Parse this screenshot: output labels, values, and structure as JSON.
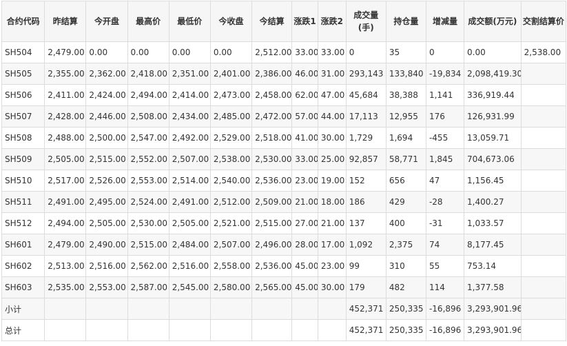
{
  "headers": [
    "合约代码",
    "昨结算",
    "今开盘",
    "最高价",
    "最低价",
    "今收盘",
    "今结算",
    "涨跌1",
    "涨跌2",
    "成交量(手)",
    "持仓量",
    "增减量",
    "成交额(万元)",
    "交割结算价"
  ],
  "rows": [
    [
      "SH504",
      "2,479.00",
      "0.00",
      "0.00",
      "0.00",
      "0.00",
      "2,512.00",
      "33.00",
      "33.00",
      "0",
      "35",
      "0",
      "0.00",
      "2,538.00"
    ],
    [
      "SH505",
      "2,355.00",
      "2,362.00",
      "2,418.00",
      "2,351.00",
      "2,401.00",
      "2,386.00",
      "46.00",
      "31.00",
      "293,143",
      "133,840",
      "-19,834",
      "2,098,419.30",
      ""
    ],
    [
      "SH506",
      "2,411.00",
      "2,424.00",
      "2,494.00",
      "2,414.00",
      "2,473.00",
      "2,458.00",
      "62.00",
      "47.00",
      "45,684",
      "38,388",
      "1,141",
      "336,919.44",
      ""
    ],
    [
      "SH507",
      "2,428.00",
      "2,446.00",
      "2,508.00",
      "2,434.00",
      "2,485.00",
      "2,472.00",
      "57.00",
      "44.00",
      "17,113",
      "12,955",
      "176",
      "126,931.99",
      ""
    ],
    [
      "SH508",
      "2,488.00",
      "2,500.00",
      "2,547.00",
      "2,492.00",
      "2,529.00",
      "2,518.00",
      "41.00",
      "30.00",
      "1,729",
      "1,694",
      "-455",
      "13,059.71",
      ""
    ],
    [
      "SH509",
      "2,505.00",
      "2,515.00",
      "2,552.00",
      "2,507.00",
      "2,538.00",
      "2,530.00",
      "33.00",
      "25.00",
      "92,857",
      "58,771",
      "1,845",
      "704,673.06",
      ""
    ],
    [
      "SH510",
      "2,517.00",
      "2,526.00",
      "2,553.00",
      "2,514.00",
      "2,540.00",
      "2,536.00",
      "23.00",
      "19.00",
      "152",
      "656",
      "47",
      "1,156.45",
      ""
    ],
    [
      "SH511",
      "2,491.00",
      "2,495.00",
      "2,524.00",
      "2,491.00",
      "2,512.00",
      "2,509.00",
      "21.00",
      "18.00",
      "186",
      "429",
      "-28",
      "1,400.27",
      ""
    ],
    [
      "SH512",
      "2,494.00",
      "2,505.00",
      "2,530.00",
      "2,505.00",
      "2,521.00",
      "2,515.00",
      "27.00",
      "21.00",
      "137",
      "400",
      "-31",
      "1,033.57",
      ""
    ],
    [
      "SH601",
      "2,479.00",
      "2,490.00",
      "2,515.00",
      "2,484.00",
      "2,507.00",
      "2,496.00",
      "28.00",
      "17.00",
      "1,092",
      "2,375",
      "74",
      "8,177.45",
      ""
    ],
    [
      "SH602",
      "2,513.00",
      "2,516.00",
      "2,562.00",
      "2,516.00",
      "2,558.00",
      "2,536.00",
      "45.00",
      "23.00",
      "99",
      "310",
      "55",
      "753.14",
      ""
    ],
    [
      "SH603",
      "2,535.00",
      "2,553.00",
      "2,587.00",
      "2,545.00",
      "2,580.00",
      "2,565.00",
      "45.00",
      "30.00",
      "179",
      "482",
      "114",
      "1,377.58",
      ""
    ]
  ],
  "summary": [
    [
      "小计",
      "",
      "",
      "",
      "",
      "",
      "",
      "",
      "",
      "452,371",
      "250,335",
      "-16,896",
      "3,293,901.96",
      ""
    ],
    [
      "总计",
      "",
      "",
      "",
      "",
      "",
      "",
      "",
      "",
      "452,371",
      "250,335",
      "-16,896",
      "3,293,901.96",
      ""
    ]
  ]
}
